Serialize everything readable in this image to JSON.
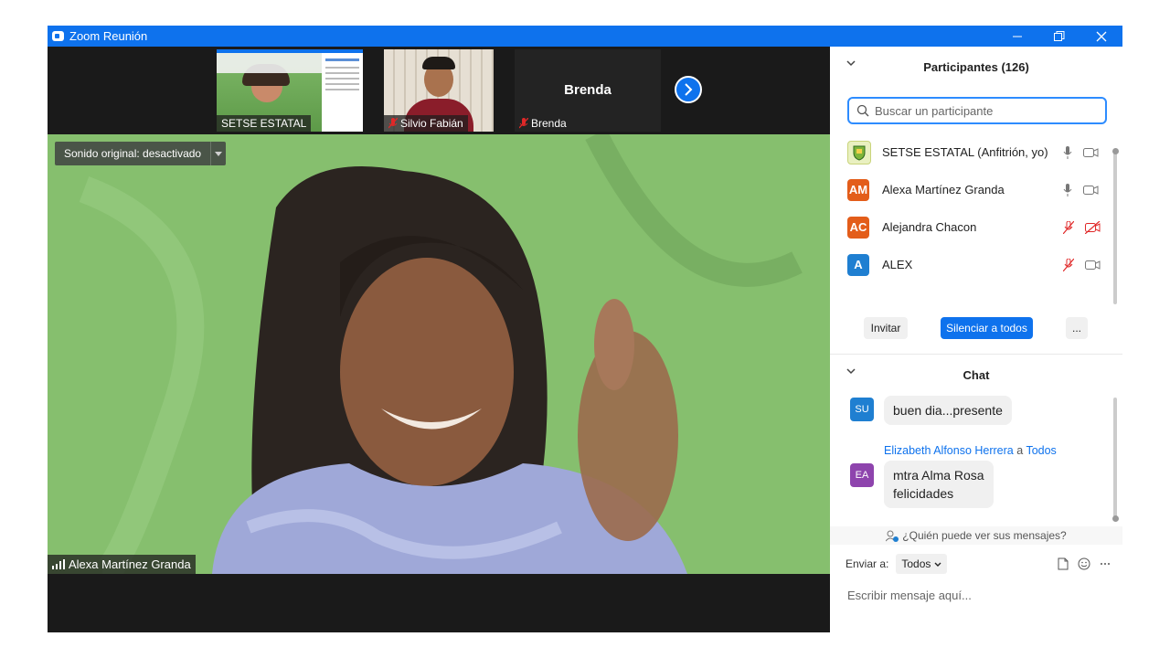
{
  "window": {
    "title": "Zoom Reunión",
    "accent": "#0e72ed"
  },
  "thumbnails": [
    {
      "name": "SETSE ESTATAL",
      "muted": false
    },
    {
      "name": "Silvio Fabián",
      "muted": true
    },
    {
      "name": "Brenda",
      "muted": true,
      "big_name": "Brenda"
    }
  ],
  "main_video": {
    "sound_label": "Sonido original: desactivado",
    "speaker_name": "Alexa Martínez Granda"
  },
  "participants": {
    "header": "Participantes (126)",
    "search_placeholder": "Buscar un participante",
    "list": [
      {
        "name": "SETSE ESTATAL (Anfitrión, yo)",
        "initials": "",
        "avatar_color": "#d8e8a0",
        "mic": "on",
        "video": "on"
      },
      {
        "name": "Alexa Martínez Granda",
        "initials": "AM",
        "avatar_color": "#e35d1a",
        "mic": "on",
        "video": "on"
      },
      {
        "name": "Alejandra Chacon",
        "initials": "AC",
        "avatar_color": "#e35d1a",
        "mic": "muted",
        "video": "off"
      },
      {
        "name": "ALEX",
        "initials": "A",
        "avatar_color": "#1f7fd1",
        "mic": "muted",
        "video": "on"
      }
    ],
    "buttons": {
      "invite": "Invitar",
      "mute_all": "Silenciar a todos",
      "more": "..."
    }
  },
  "chat": {
    "header": "Chat",
    "messages": [
      {
        "initials": "SU",
        "avatar_color": "#1f7fd1",
        "text": "buen dia...presente"
      },
      {
        "initials": "EA",
        "avatar_color": "#8e44ad",
        "sender": "Elizabeth Alfonso Herrera",
        "to_word": "a",
        "recipient": "Todos",
        "text_line1": "mtra Alma Rosa",
        "text_line2": "felicidades"
      }
    ],
    "who_can_see": "¿Quién puede ver sus mensajes?",
    "send_to_label": "Enviar a:",
    "send_to_value": "Todos",
    "input_placeholder": "Escribir mensaje aquí..."
  }
}
